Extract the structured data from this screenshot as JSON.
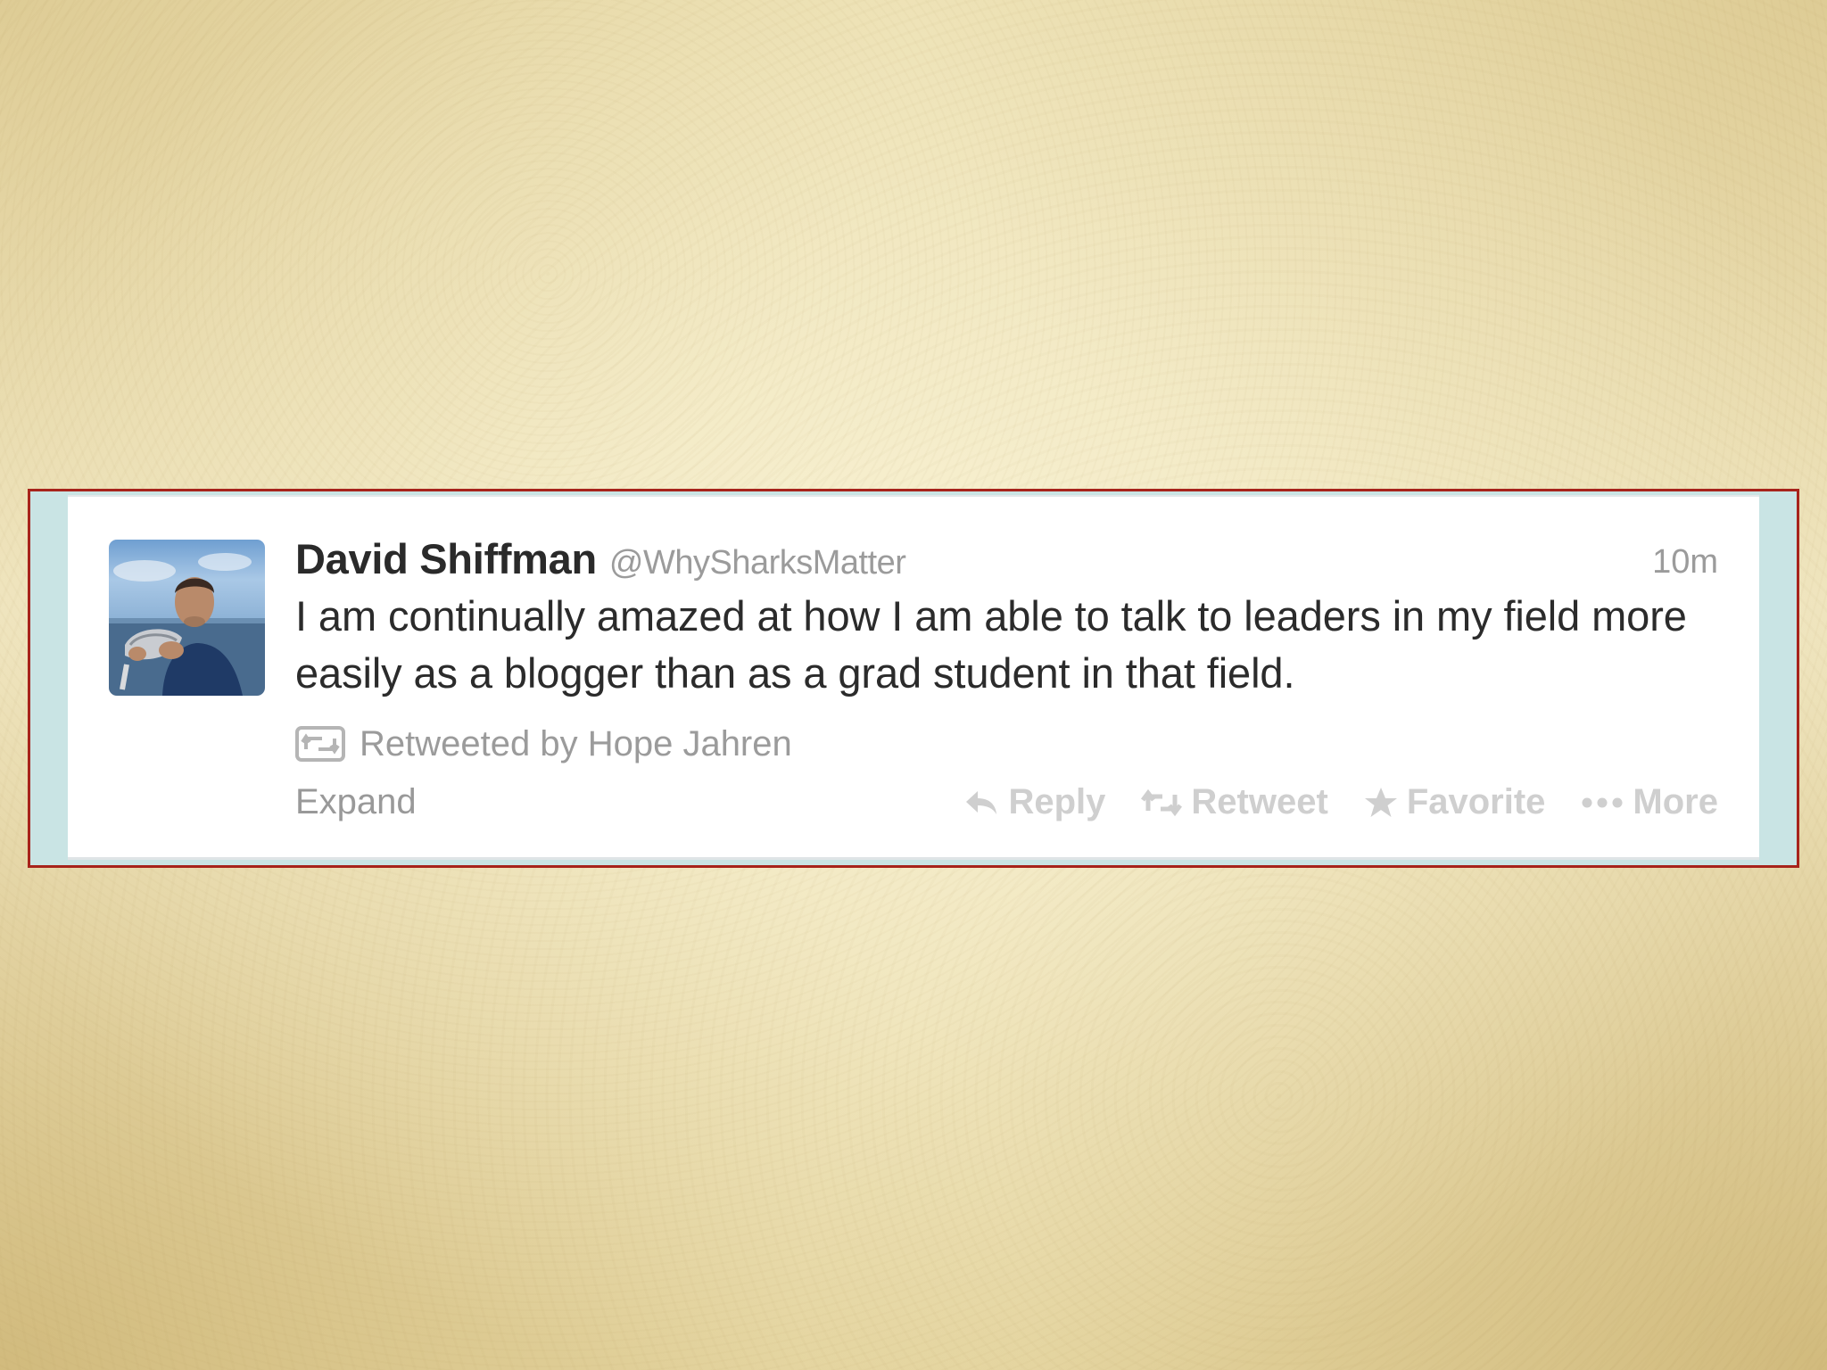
{
  "tweet": {
    "display_name": "David Shiffman",
    "username": "@WhySharksMatter",
    "timestamp": "10m",
    "text": "I am continually amazed at how I am able to talk to leaders in my field more easily as a blogger than as a grad student in that field.",
    "retweet_context": "Retweeted by Hope Jahren",
    "expand_label": "Expand",
    "actions": {
      "reply": "Reply",
      "retweet": "Retweet",
      "favorite": "Favorite",
      "more": "More"
    },
    "avatar_icon": "profile-photo",
    "retweet_icon": "retweet-icon"
  },
  "colors": {
    "frame_border": "#a7231b",
    "frame_side": "#c9e4e4",
    "name": "#2a2a2a",
    "muted": "#9b9b9b",
    "action_muted": "#cfcfcf"
  }
}
